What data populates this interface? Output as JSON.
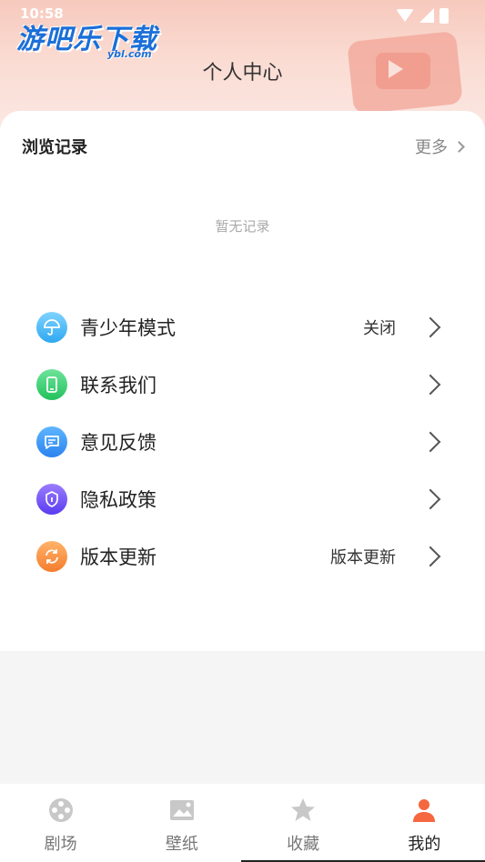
{
  "status_bar": {
    "time": "10:58"
  },
  "header": {
    "logo_text": "游吧乐下载",
    "logo_sub": "ybl.com",
    "title": "个人中心"
  },
  "history": {
    "title": "浏览记录",
    "more": "更多",
    "empty_text": "暂无记录"
  },
  "menu": [
    {
      "label": "青少年模式",
      "value": "关闭",
      "icon": "umbrella-icon"
    },
    {
      "label": "联系我们",
      "value": "",
      "icon": "phone-icon"
    },
    {
      "label": "意见反馈",
      "value": "",
      "icon": "message-icon"
    },
    {
      "label": "隐私政策",
      "value": "",
      "icon": "shield-icon"
    },
    {
      "label": "版本更新",
      "value": "版本更新",
      "icon": "refresh-icon"
    }
  ],
  "tabs": [
    {
      "label": "剧场",
      "icon": "film-reel-icon",
      "active": false
    },
    {
      "label": "壁纸",
      "icon": "image-icon",
      "active": false
    },
    {
      "label": "收藏",
      "icon": "star-icon",
      "active": false
    },
    {
      "label": "我的",
      "icon": "user-icon",
      "active": true
    }
  ],
  "colors": {
    "accent_active_tab": "#f5673f",
    "inactive_icon": "#c8c8c8"
  }
}
